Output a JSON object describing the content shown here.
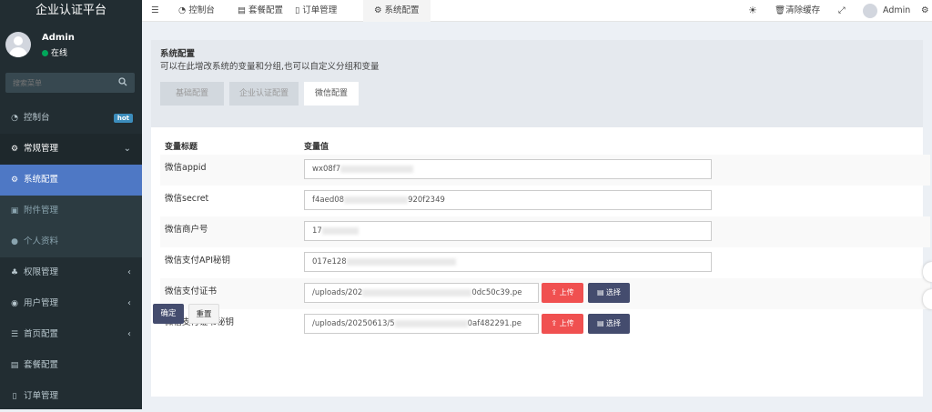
{
  "app": {
    "title": "企业认证平台"
  },
  "user": {
    "name": "Admin",
    "status": "在线"
  },
  "search": {
    "placeholder": "搜索菜单"
  },
  "sidebar": {
    "items": [
      {
        "label": "控制台",
        "badge": "hot"
      },
      {
        "label": "常规管理"
      },
      {
        "label": "系统配置"
      },
      {
        "label": "附件管理"
      },
      {
        "label": "个人资料"
      },
      {
        "label": "权限管理"
      },
      {
        "label": "用户管理"
      },
      {
        "label": "首页配置"
      },
      {
        "label": "套餐配置"
      },
      {
        "label": "订单管理"
      }
    ]
  },
  "topbar": {
    "tabs": [
      {
        "label": "控制台"
      },
      {
        "label": "套餐配置"
      },
      {
        "label": "订单管理"
      },
      {
        "label": "系统配置"
      }
    ],
    "clear_cache": "清除缓存",
    "user": "Admin"
  },
  "page": {
    "title": "系统配置",
    "subtitle": "可以在此增改系统的变量和分组,也可以自定义分组和变量",
    "tabs": [
      {
        "label": "基础配置"
      },
      {
        "label": "企业认证配置"
      },
      {
        "label": "微信配置"
      }
    ]
  },
  "table": {
    "headers": [
      "变量标题",
      "变量值"
    ],
    "rows": [
      {
        "label": "微信appid",
        "value": "wx08f7"
      },
      {
        "label": "微信secret",
        "value": "f4aed08",
        "value_tail": "920f2349"
      },
      {
        "label": "微信商户号",
        "value": "17"
      },
      {
        "label": "微信支付API秘钥",
        "value": "017e128"
      },
      {
        "label": "微信支付证书",
        "value": "/uploads/202",
        "value_tail": "0dc50c39.pe"
      },
      {
        "label": "微信支付证书秘钥",
        "value": "/uploads/20250613/5",
        "value_tail": "0af482291.pe"
      }
    ],
    "upload_label": "上传",
    "select_label": "选择"
  },
  "actions": {
    "confirm": "确定",
    "reset": "重置"
  },
  "colors": {
    "sidebar_bg": "#222d32",
    "active": "#4e78c5",
    "danger": "#f05050",
    "dark_button": "#444c6e",
    "online": "#00a65a",
    "hot_badge": "#3c8dbc"
  }
}
